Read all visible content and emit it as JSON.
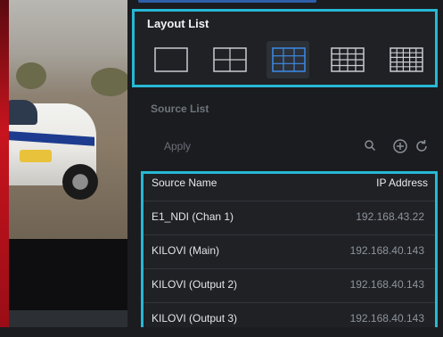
{
  "layout_list": {
    "title": "Layout List",
    "options": [
      {
        "name": "1x1",
        "selected": false
      },
      {
        "name": "2x2",
        "selected": false
      },
      {
        "name": "3x3",
        "selected": true
      },
      {
        "name": "4x4",
        "selected": false
      },
      {
        "name": "5x5",
        "selected": false
      }
    ]
  },
  "source_list": {
    "title": "Source List",
    "search_placeholder": "Apply",
    "icons": [
      "search-icon",
      "add-icon",
      "refresh-icon"
    ]
  },
  "source_table": {
    "columns": [
      "Source Name",
      "IP Address"
    ],
    "rows": [
      {
        "name": "E1_NDI (Chan 1)",
        "ip": "192.168.43.22"
      },
      {
        "name": "KILOVI (Main)",
        "ip": "192.168.40.143"
      },
      {
        "name": "KILOVI (Output 2)",
        "ip": "192.168.40.143"
      },
      {
        "name": "KILOVI (Output 3)",
        "ip": "192.168.40.143"
      }
    ]
  },
  "colors": {
    "highlight_border": "#27b8d4",
    "selected_layout": "#3d8be8",
    "layout_icon": "#c9ccd1"
  }
}
